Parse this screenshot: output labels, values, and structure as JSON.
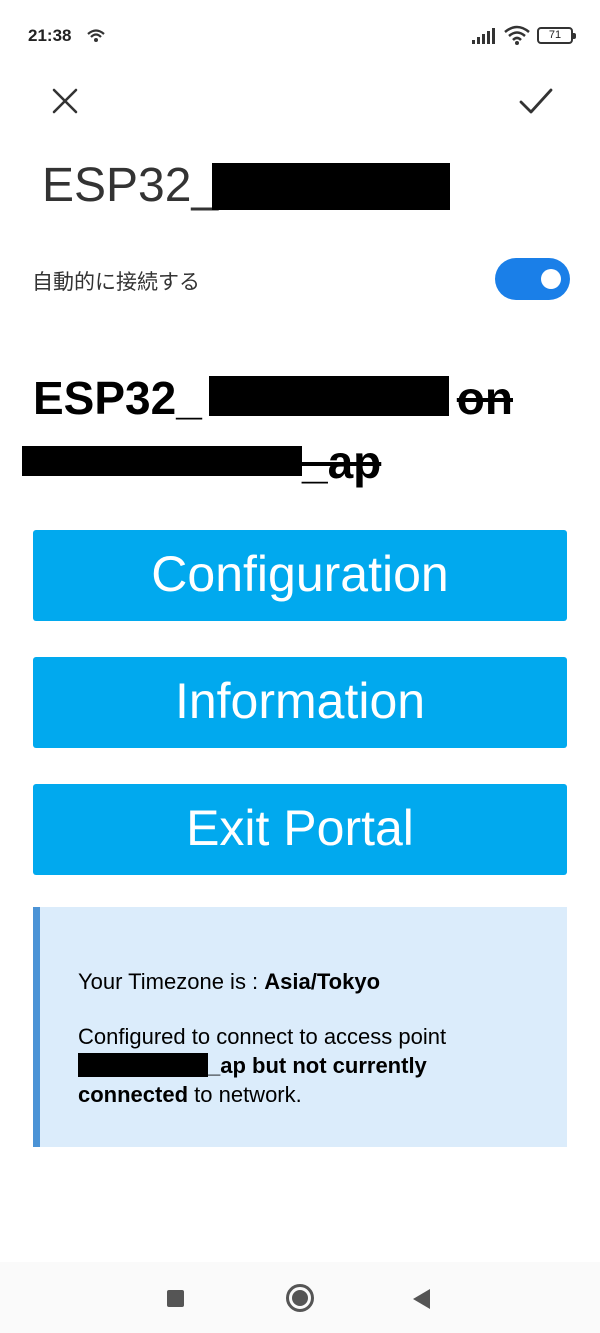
{
  "status_bar": {
    "time": "21:38",
    "battery": "71",
    "icons": [
      "wifi-small-icon",
      "signal-icon",
      "wifi-icon",
      "battery-icon"
    ]
  },
  "header": {
    "close_icon": "close-icon",
    "confirm_icon": "check-icon",
    "ssid_prefix": "ESP32_"
  },
  "auto_connect": {
    "label": "自動的に接続する",
    "enabled": true,
    "accent": "#1a7fe8"
  },
  "portal": {
    "heading_prefix": "ESP32_",
    "heading_on": "on",
    "heading_ap": "_ap",
    "buttons": [
      "Configuration",
      "Information",
      "Exit Portal"
    ],
    "button_color": "#01a9ee"
  },
  "info": {
    "tz_label": "Your Timezone is : ",
    "tz_value": "Asia/Tokyo",
    "msg_prefix": "Configured to connect to access point",
    "msg_ap_bold": "_ap but not currently",
    "msg_connected_bold": "connected",
    "msg_suffix": " to network.",
    "bg": "#dbecfb",
    "border": "#4b93d6"
  },
  "nav": {
    "icons": [
      "recents-icon",
      "home-icon",
      "back-icon"
    ]
  }
}
